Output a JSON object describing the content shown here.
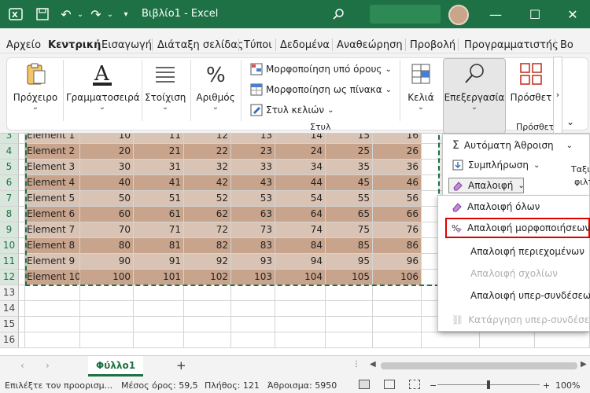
{
  "title_bar": {
    "app_icon": "excel-icon",
    "title": "Βιβλίο1 - Excel",
    "minimize": "—",
    "maximize": "☐",
    "close": "✕"
  },
  "menu": {
    "tabs": [
      "Αρχείο",
      "Κεντρική",
      "Εισαγωγή",
      "Διάταξη σελίδας",
      "Τύποι",
      "Δεδομένα",
      "Αναθεώρηση",
      "Προβολή",
      "Προγραμματιστής",
      "Βο"
    ],
    "active_tab": "Κεντρική"
  },
  "ribbon": {
    "clipboard": "Πρόχειρο",
    "font": "Γραμματοσειρά",
    "alignment": "Στοίχιση",
    "number": "Αριθμός",
    "conditional_formatting": "Μορφοποίηση υπό όρους",
    "format_as_table": "Μορφοποίηση ως πίνακα",
    "cell_styles": "Στυλ κελιών",
    "styles_group": "Στυλ",
    "cells": "Κελιά",
    "editing": "Επεξεργασία",
    "addins": "Πρόσθετ",
    "addins_group": "Πρόσθετ"
  },
  "sheet": {
    "row_numbers": [
      "3",
      "4",
      "5",
      "6",
      "7",
      "8",
      "9",
      "10",
      "11",
      "12",
      "13",
      "14",
      "15",
      "16"
    ],
    "rows": [
      {
        "label": "Element 1",
        "values": [
          "10",
          "11",
          "12",
          "13",
          "14",
          "15",
          "16"
        ]
      },
      {
        "label": "Element 2",
        "values": [
          "20",
          "21",
          "22",
          "23",
          "24",
          "25",
          "26"
        ]
      },
      {
        "label": "Element 3",
        "values": [
          "30",
          "31",
          "32",
          "33",
          "34",
          "35",
          "36"
        ]
      },
      {
        "label": "Element 4",
        "values": [
          "40",
          "41",
          "42",
          "43",
          "44",
          "45",
          "46"
        ]
      },
      {
        "label": "Element 5",
        "values": [
          "50",
          "51",
          "52",
          "53",
          "54",
          "55",
          "56"
        ]
      },
      {
        "label": "Element 6",
        "values": [
          "60",
          "61",
          "62",
          "63",
          "64",
          "65",
          "66"
        ]
      },
      {
        "label": "Element 7",
        "values": [
          "70",
          "71",
          "72",
          "73",
          "74",
          "75",
          "76"
        ]
      },
      {
        "label": "Element 8",
        "values": [
          "80",
          "81",
          "82",
          "83",
          "84",
          "85",
          "86"
        ]
      },
      {
        "label": "Element 9",
        "values": [
          "90",
          "91",
          "92",
          "93",
          "94",
          "95",
          "96"
        ]
      },
      {
        "label": "Element 10",
        "values": [
          "100",
          "101",
          "102",
          "103",
          "104",
          "105",
          "106"
        ]
      }
    ],
    "colors": {
      "band_dark": "#c8a48c",
      "band_light": "#d9c3b4"
    }
  },
  "editing_menu": {
    "autosum": "Αυτόματη Άθροιση",
    "fill": "Συμπλήρωση",
    "clear": "Απαλοιφή",
    "clear_all": "Απαλοιφή όλων",
    "clear_formats": "Απαλοιφή μορφοποιήσεων",
    "clear_contents": "Απαλοιφή περιεχομένων",
    "clear_comments": "Απαλοιφή σχολίων",
    "clear_hyperlinks": "Απαλοιφή υπερ-συνδέσεων",
    "remove_hyperlinks": "Κατάργηση υπερ-συνδέσεων",
    "side_text_1": "Ταξιν",
    "side_text_2": "φιλτ"
  },
  "sheet_tabs": {
    "active": "Φύλλο1",
    "add": "+"
  },
  "status": {
    "mode": "Επιλέξτε τον προορισμ...",
    "average": "Μέσος όρος: 59,5",
    "count": "Πλήθος: 121",
    "sum": "Άθροισμα: 5950",
    "zoom": "100%",
    "zoom_minus": "−",
    "zoom_plus": "+"
  }
}
